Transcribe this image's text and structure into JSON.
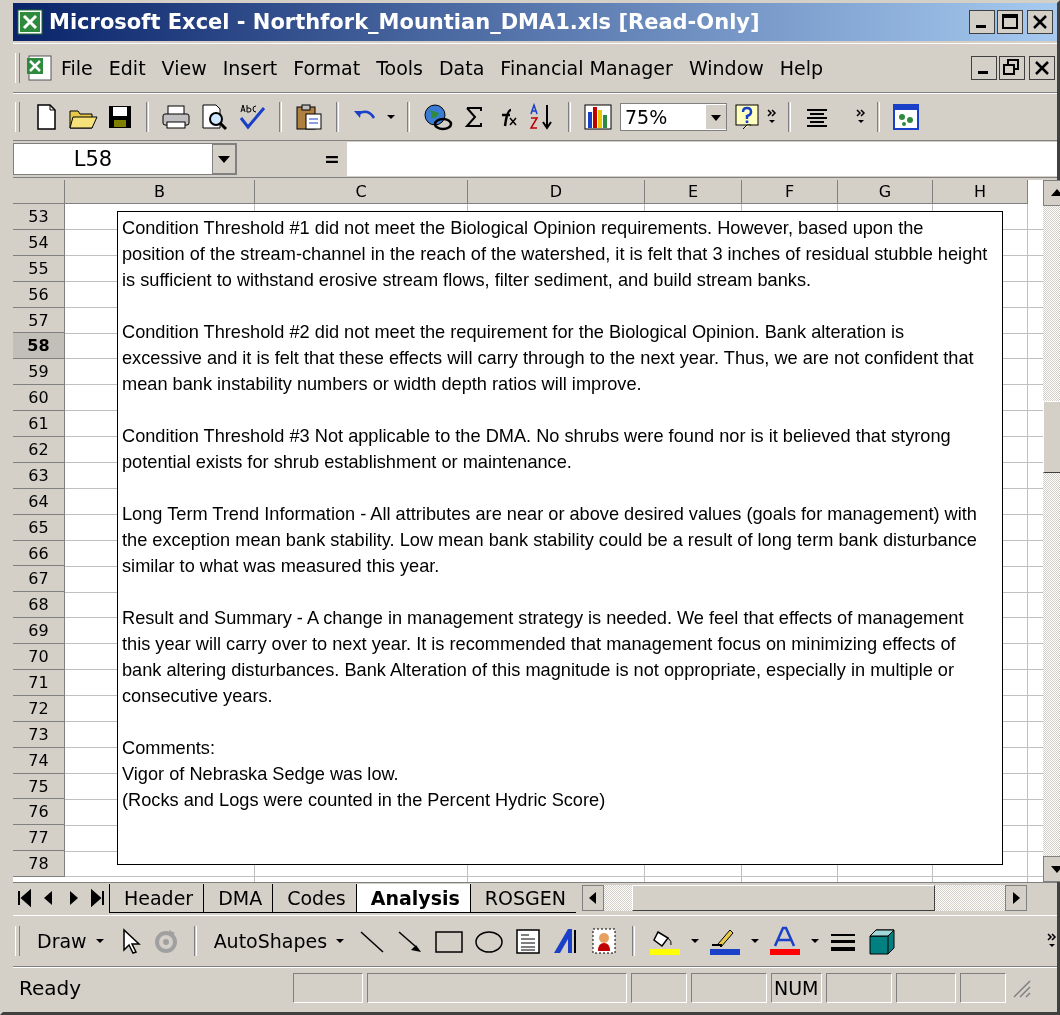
{
  "window": {
    "title": "Microsoft Excel - Northfork_Mountian_DMA1.xls  [Read-Only]"
  },
  "menu": {
    "items": [
      "File",
      "Edit",
      "View",
      "Insert",
      "Format",
      "Tools",
      "Data",
      "Financial Manager",
      "Window",
      "Help"
    ]
  },
  "toolbar": {
    "zoom": "75%"
  },
  "formula_bar": {
    "name_box": "L58",
    "equals": "="
  },
  "columns": [
    "B",
    "C",
    "D",
    "E",
    "F",
    "G",
    "H"
  ],
  "rows": [
    {
      "number": "53",
      "selected": false
    },
    {
      "number": "54",
      "selected": false
    },
    {
      "number": "55",
      "selected": false
    },
    {
      "number": "56",
      "selected": false
    },
    {
      "number": "57",
      "selected": false
    },
    {
      "number": "58",
      "selected": true
    },
    {
      "number": "59",
      "selected": false
    },
    {
      "number": "60",
      "selected": false
    },
    {
      "number": "61",
      "selected": false
    },
    {
      "number": "62",
      "selected": false
    },
    {
      "number": "63",
      "selected": false
    },
    {
      "number": "64",
      "selected": false
    },
    {
      "number": "65",
      "selected": false
    },
    {
      "number": "66",
      "selected": false
    },
    {
      "number": "67",
      "selected": false
    },
    {
      "number": "68",
      "selected": false
    },
    {
      "number": "69",
      "selected": false
    },
    {
      "number": "70",
      "selected": false
    },
    {
      "number": "71",
      "selected": false
    },
    {
      "number": "72",
      "selected": false
    },
    {
      "number": "73",
      "selected": false
    },
    {
      "number": "74",
      "selected": false
    },
    {
      "number": "75",
      "selected": false
    },
    {
      "number": "76",
      "selected": false
    },
    {
      "number": "77",
      "selected": false
    },
    {
      "number": "78",
      "selected": false
    }
  ],
  "text_box": {
    "paragraphs": [
      {
        "lines": [
          "Condition Threshold #1 did not meet the Biological Opinion requirements.  However, based upon the",
          "position of the stream-channel in the reach of the watershed, it is felt that 3 inches of residual stubble height",
          "is sufficient to withstand erosive stream flows, filter sediment, and build stream banks."
        ]
      },
      {
        "lines": [
          "Condition Threshold #2 did not meet the requirement for the Biological Opinion.  Bank alteration is",
          "excessive and it is felt that these effects will carry through to the next year.  Thus, we are not confident that",
          "mean bank instability numbers or width depth ratios will improve."
        ]
      },
      {
        "lines": [
          "Condition Threshold #3 Not applicable to the DMA.  No shrubs were found nor is it believed that styrong",
          "potential exists for shrub establishment or maintenance."
        ]
      },
      {
        "lines": [
          "Long Term Trend Information - All attributes are near or above desired values (goals for management) with",
          "the exception mean bank stability.  Low mean bank stability could be a result of long term bank disturbance",
          "similar to what was measured this year."
        ]
      },
      {
        "lines": [
          "Result and Summary - A change in management strategy is needed.  We feel that effects of management",
          "this year will carry over to next year.  It is recommended that management focus on minimizing effects of",
          "bank altering disturbances.  Bank Alteration of this magnitude is not oppropriate, especially in multiple or",
          "consecutive years."
        ]
      },
      {
        "lines": [
          "Comments:",
          "Vigor of Nebraska Sedge was low.",
          "(Rocks and Logs were counted in the Percent Hydric Score)"
        ]
      }
    ]
  },
  "sheet_tabs": [
    {
      "label": "Header",
      "selected": false
    },
    {
      "label": "DMA",
      "selected": false
    },
    {
      "label": "Codes",
      "selected": false
    },
    {
      "label": "Analysis",
      "selected": true
    },
    {
      "label": "ROSGEN",
      "selected": false
    }
  ],
  "drawing_toolbar": {
    "draw": "Draw",
    "autoshapes": "AutoShapes"
  },
  "status_bar": {
    "status": "Ready",
    "num": "NUM"
  }
}
